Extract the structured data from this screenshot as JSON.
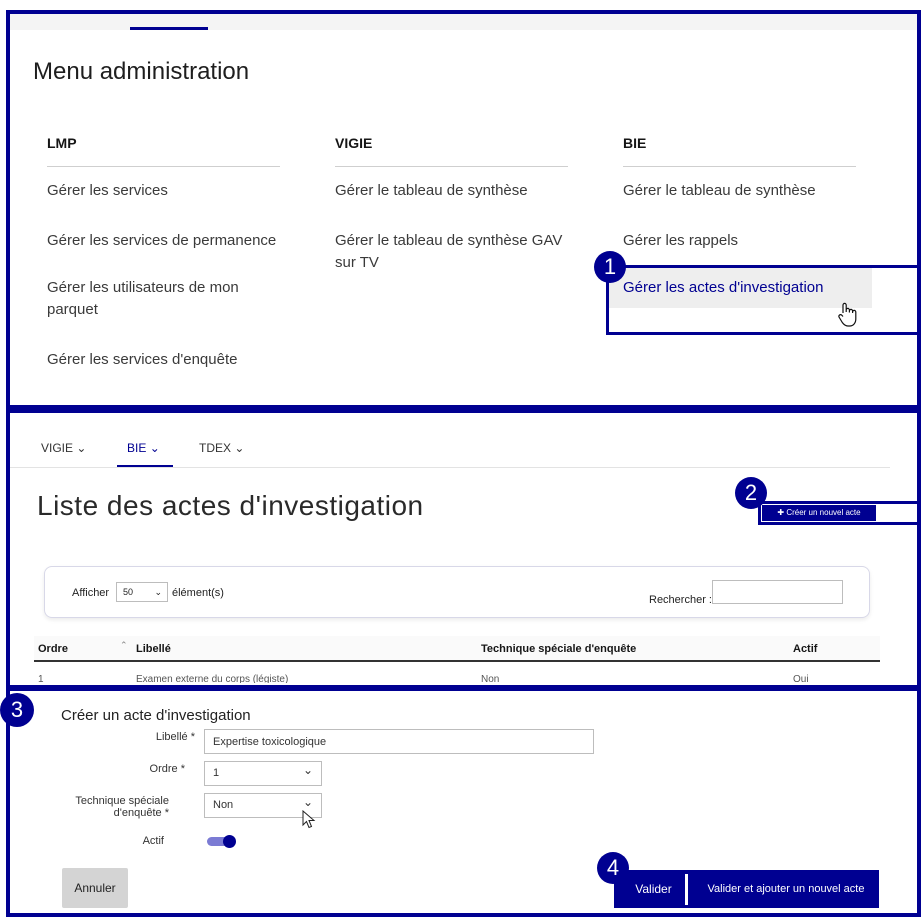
{
  "admin_menu": {
    "title": "Menu administration",
    "columns": [
      {
        "heading": "LMP",
        "links": [
          "Gérer les services",
          "Gérer les services de permanence",
          "Gérer les utilisateurs de mon parquet",
          "Gérer les services d'enquête"
        ]
      },
      {
        "heading": "VIGIE",
        "links": [
          "Gérer le tableau de synthèse",
          "Gérer le tableau de synthèse GAV sur TV"
        ]
      },
      {
        "heading": "BIE",
        "links": [
          "Gérer le tableau de synthèse",
          "Gérer les rappels",
          "Gérer les actes d'investigation"
        ]
      }
    ]
  },
  "steps": [
    "1",
    "2",
    "3",
    "4"
  ],
  "list_page": {
    "tabs": [
      "VIGIE",
      "BIE",
      "TDEX"
    ],
    "active_tab": "BIE",
    "title": "Liste des actes d'investigation",
    "create_button": "Créer un nouvel acte",
    "show_label": "Afficher",
    "page_size": "50",
    "elements_label": "élément(s)",
    "search_label": "Rechercher :",
    "search_value": "",
    "columns": [
      "Ordre",
      "Libellé",
      "Technique spéciale d'enquête",
      "Actif"
    ],
    "partial_row": [
      "1",
      "Examen externe du corps (légiste)",
      "Non",
      "Oui"
    ]
  },
  "create_form": {
    "title": "Créer un acte d'investigation",
    "libelle_label": "Libellé *",
    "libelle_value": "Expertise toxicologique",
    "ordre_label": "Ordre *",
    "ordre_value": "1",
    "technique_label_1": "Technique spéciale",
    "technique_label_2": "d'enquête *",
    "technique_value": "Non",
    "actif_label": "Actif",
    "actif_on": true,
    "cancel_button": "Annuler",
    "validate_button": "Valider",
    "validate_add_button": "Valider et ajouter un nouvel acte"
  },
  "colors": {
    "accent": "#000091"
  }
}
